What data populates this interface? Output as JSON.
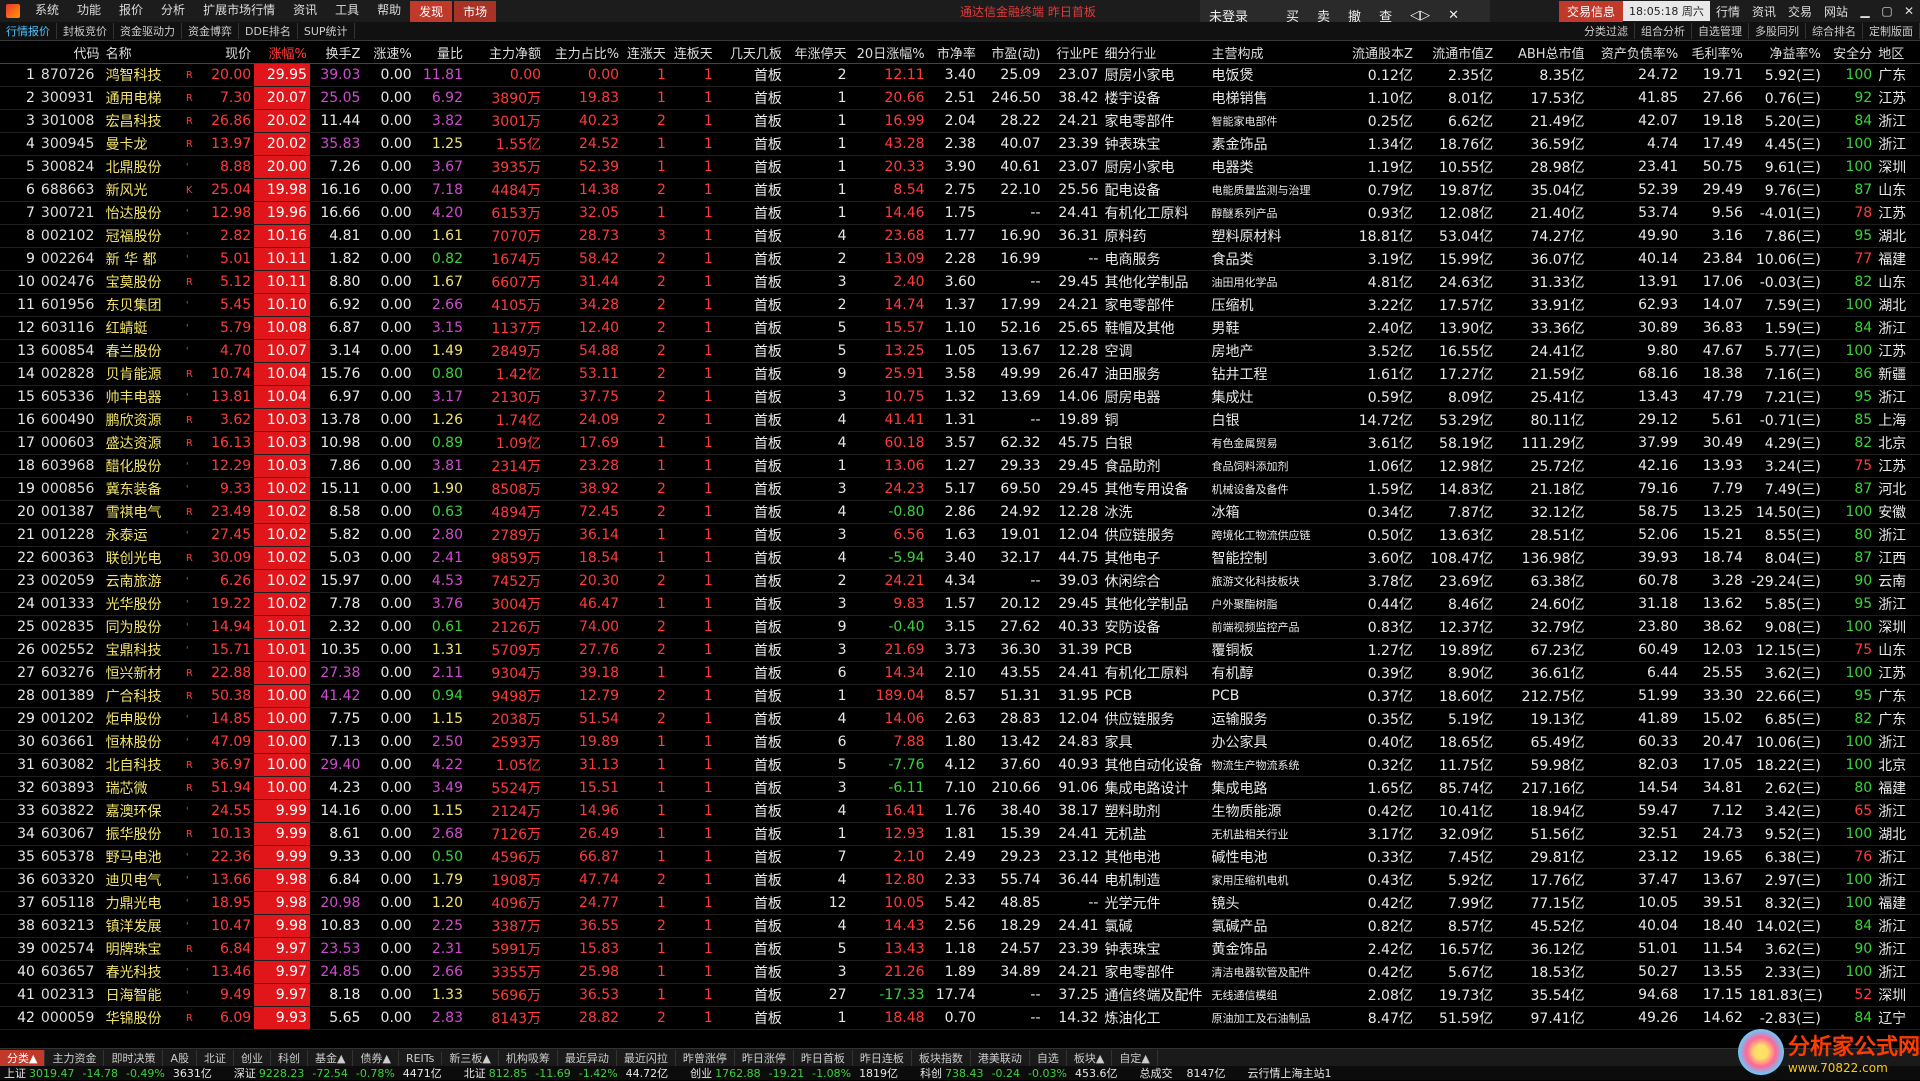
{
  "menubar": {
    "items": [
      "系统",
      "功能",
      "报价",
      "分析",
      "扩展市场行情",
      "资讯",
      "工具",
      "帮助"
    ],
    "highlight": [
      "发现",
      "市场"
    ],
    "marquee": "通达信金融终端  昨日首板",
    "ctrl": [
      "未登录",
      "买",
      "卖",
      "撤",
      "查",
      "◁▷",
      "✕"
    ],
    "right": {
      "trade_info": "交易信息",
      "clock": "18:05:18 周六",
      "items": [
        "行情",
        "资讯",
        "交易",
        "网站"
      ]
    }
  },
  "subbar": {
    "left": [
      "行情报价",
      "封板竞价",
      "资金驱动力",
      "资金博弈",
      "DDE排名",
      "SUP统计"
    ],
    "right": [
      "分类过滤",
      "组合分析",
      "自选管理",
      "多股同列",
      "综合排名",
      "定制版面"
    ]
  },
  "columns": [
    "",
    "代码",
    "名称",
    "",
    "现价",
    "涨幅%",
    "换手Z",
    "涨速%",
    "量比",
    "主力净额",
    "主力占比%",
    "连涨天",
    "连板天",
    "几天几板",
    "年涨停天",
    "20日涨幅%",
    "市净率",
    "市盈(动)",
    "行业PE",
    "细分行业",
    "主营构成",
    "流通股本Z",
    "流通市值Z",
    "ABH总市值",
    "资产负债率%",
    "毛利率%",
    "净益率%",
    "安全分",
    "地区"
  ],
  "rows": [
    [
      "1",
      "870726",
      "鸿智科技",
      "R",
      "20.00",
      "29.95",
      "39.03",
      "0.00",
      "11.81",
      "0.00",
      "0.00",
      "1",
      "1",
      "首板",
      "2",
      "12.11",
      "3.40",
      "25.09",
      "23.07",
      "厨房小家电",
      "电饭煲",
      "0.12亿",
      "2.35亿",
      "8.35亿",
      "24.72",
      "19.71",
      "5.92(三)",
      "100",
      "广东"
    ],
    [
      "2",
      "300931",
      "通用电梯",
      "R",
      "7.30",
      "20.07",
      "25.05",
      "0.00",
      "6.92",
      "3890万",
      "19.83",
      "1",
      "1",
      "首板",
      "1",
      "20.66",
      "2.51",
      "246.50",
      "38.42",
      "楼宇设备",
      "电梯销售",
      "1.10亿",
      "8.01亿",
      "17.53亿",
      "41.85",
      "27.66",
      "0.76(三)",
      "92",
      "江苏"
    ],
    [
      "3",
      "301008",
      "宏昌科技",
      "R",
      "26.86",
      "20.02",
      "11.44",
      "0.00",
      "3.82",
      "3001万",
      "40.23",
      "2",
      "1",
      "首板",
      "1",
      "16.99",
      "2.04",
      "28.22",
      "24.21",
      "家电零部件",
      "智能家电部件",
      "0.25亿",
      "6.62亿",
      "21.49亿",
      "42.07",
      "19.18",
      "5.20(三)",
      "84",
      "浙江"
    ],
    [
      "4",
      "300945",
      "曼卡龙",
      "R",
      "13.97",
      "20.02",
      "35.83",
      "0.00",
      "1.25",
      "1.55亿",
      "24.52",
      "1",
      "1",
      "首板",
      "1",
      "43.28",
      "2.38",
      "40.07",
      "23.39",
      "钟表珠宝",
      "素金饰品",
      "1.34亿",
      "18.76亿",
      "36.59亿",
      "4.74",
      "17.49",
      "4.45(三)",
      "100",
      "浙江"
    ],
    [
      "5",
      "300824",
      "北鼎股份",
      "'",
      "8.88",
      "20.00",
      "7.26",
      "0.00",
      "3.67",
      "3935万",
      "52.39",
      "1",
      "1",
      "首板",
      "1",
      "20.33",
      "3.90",
      "40.61",
      "23.07",
      "厨房小家电",
      "电器类",
      "1.19亿",
      "10.55亿",
      "28.98亿",
      "23.41",
      "50.75",
      "9.61(三)",
      "100",
      "深圳"
    ],
    [
      "6",
      "688663",
      "新风光",
      "K",
      "25.04",
      "19.98",
      "16.16",
      "0.00",
      "7.18",
      "4484万",
      "14.38",
      "2",
      "1",
      "首板",
      "1",
      "8.54",
      "2.75",
      "22.10",
      "25.56",
      "配电设备",
      "电能质量监测与治理",
      "0.79亿",
      "19.87亿",
      "35.04亿",
      "52.39",
      "29.49",
      "9.76(三)",
      "87",
      "山东"
    ],
    [
      "7",
      "300721",
      "怡达股份",
      "'",
      "12.98",
      "19.96",
      "16.66",
      "0.00",
      "4.20",
      "6153万",
      "32.05",
      "1",
      "1",
      "首板",
      "1",
      "14.46",
      "1.75",
      "--",
      "24.41",
      "有机化工原料",
      "醇醚系列产品",
      "0.93亿",
      "12.08亿",
      "21.40亿",
      "53.74",
      "9.56",
      "-4.01(三)",
      "78",
      "江苏"
    ],
    [
      "8",
      "002102",
      "冠福股份",
      "'",
      "2.82",
      "10.16",
      "4.81",
      "0.00",
      "1.61",
      "7070万",
      "28.73",
      "3",
      "1",
      "首板",
      "4",
      "23.68",
      "1.77",
      "16.90",
      "36.31",
      "原料药",
      "塑料原材料",
      "18.81亿",
      "53.04亿",
      "74.27亿",
      "49.90",
      "3.16",
      "7.86(三)",
      "95",
      "湖北"
    ],
    [
      "9",
      "002264",
      "新 华 都",
      "'",
      "5.01",
      "10.11",
      "1.82",
      "0.00",
      "0.82",
      "1674万",
      "58.42",
      "2",
      "1",
      "首板",
      "2",
      "13.09",
      "2.28",
      "16.99",
      "--",
      "电商服务",
      "食品类",
      "3.19亿",
      "15.99亿",
      "36.07亿",
      "40.14",
      "23.84",
      "10.06(三)",
      "77",
      "福建"
    ],
    [
      "10",
      "002476",
      "宝莫股份",
      "R",
      "5.12",
      "10.11",
      "8.80",
      "0.00",
      "1.67",
      "6607万",
      "31.44",
      "2",
      "1",
      "首板",
      "3",
      "2.40",
      "3.60",
      "--",
      "29.45",
      "其他化学制品",
      "油田用化学品",
      "4.81亿",
      "24.63亿",
      "31.33亿",
      "13.91",
      "17.06",
      "-0.03(三)",
      "82",
      "山东"
    ],
    [
      "11",
      "601956",
      "东贝集团",
      "'",
      "5.45",
      "10.10",
      "6.92",
      "0.00",
      "2.66",
      "4105万",
      "34.28",
      "2",
      "1",
      "首板",
      "2",
      "14.74",
      "1.37",
      "17.99",
      "24.21",
      "家电零部件",
      "压缩机",
      "3.22亿",
      "17.57亿",
      "33.91亿",
      "62.93",
      "14.07",
      "7.59(三)",
      "100",
      "湖北"
    ],
    [
      "12",
      "603116",
      "红蜻蜓",
      "'",
      "5.79",
      "10.08",
      "6.87",
      "0.00",
      "3.15",
      "1137万",
      "12.40",
      "2",
      "1",
      "首板",
      "5",
      "15.57",
      "1.10",
      "52.16",
      "25.65",
      "鞋帽及其他",
      "男鞋",
      "2.40亿",
      "13.90亿",
      "33.36亿",
      "30.89",
      "36.83",
      "1.59(三)",
      "84",
      "浙江"
    ],
    [
      "13",
      "600854",
      "春兰股份",
      "'",
      "4.70",
      "10.07",
      "3.14",
      "0.00",
      "1.49",
      "2849万",
      "54.88",
      "2",
      "1",
      "首板",
      "5",
      "13.25",
      "1.05",
      "13.67",
      "12.28",
      "空调",
      "房地产",
      "3.52亿",
      "16.55亿",
      "24.41亿",
      "9.80",
      "47.67",
      "5.77(三)",
      "100",
      "江苏"
    ],
    [
      "14",
      "002828",
      "贝肯能源",
      "R",
      "10.74",
      "10.04",
      "15.76",
      "0.00",
      "0.80",
      "1.42亿",
      "53.11",
      "2",
      "1",
      "首板",
      "9",
      "25.91",
      "3.58",
      "49.99",
      "26.47",
      "油田服务",
      "钻井工程",
      "1.61亿",
      "17.27亿",
      "21.59亿",
      "68.16",
      "18.38",
      "7.16(三)",
      "86",
      "新疆"
    ],
    [
      "15",
      "605336",
      "帅丰电器",
      "'",
      "13.81",
      "10.04",
      "6.97",
      "0.00",
      "3.17",
      "2130万",
      "37.75",
      "2",
      "1",
      "首板",
      "3",
      "10.75",
      "1.32",
      "13.69",
      "14.06",
      "厨房电器",
      "集成灶",
      "0.59亿",
      "8.09亿",
      "25.41亿",
      "13.43",
      "47.79",
      "7.21(三)",
      "95",
      "浙江"
    ],
    [
      "16",
      "600490",
      "鹏欣资源",
      "R",
      "3.62",
      "10.03",
      "13.78",
      "0.00",
      "1.26",
      "1.74亿",
      "24.09",
      "2",
      "1",
      "首板",
      "4",
      "41.41",
      "1.31",
      "--",
      "19.89",
      "铜",
      "白银",
      "14.72亿",
      "53.29亿",
      "80.11亿",
      "29.12",
      "5.61",
      "-0.71(三)",
      "85",
      "上海"
    ],
    [
      "17",
      "000603",
      "盛达资源",
      "R",
      "16.13",
      "10.03",
      "10.98",
      "0.00",
      "0.89",
      "1.09亿",
      "17.69",
      "1",
      "1",
      "首板",
      "4",
      "60.18",
      "3.57",
      "62.32",
      "45.75",
      "白银",
      "有色金属贸易",
      "3.61亿",
      "58.19亿",
      "111.29亿",
      "37.99",
      "30.49",
      "4.29(三)",
      "82",
      "北京"
    ],
    [
      "18",
      "603968",
      "醋化股份",
      "'",
      "12.29",
      "10.03",
      "7.86",
      "0.00",
      "3.81",
      "2314万",
      "23.28",
      "1",
      "1",
      "首板",
      "1",
      "13.06",
      "1.27",
      "29.33",
      "29.45",
      "食品助剂",
      "食品饲料添加剂",
      "1.06亿",
      "12.98亿",
      "25.72亿",
      "42.16",
      "13.93",
      "3.24(三)",
      "75",
      "江苏"
    ],
    [
      "19",
      "000856",
      "冀东装备",
      "'",
      "9.33",
      "10.02",
      "15.11",
      "0.00",
      "1.90",
      "8508万",
      "38.92",
      "2",
      "1",
      "首板",
      "3",
      "24.23",
      "5.17",
      "69.50",
      "29.45",
      "其他专用设备",
      "机械设备及备件",
      "1.59亿",
      "14.83亿",
      "21.18亿",
      "79.16",
      "7.79",
      "7.49(三)",
      "87",
      "河北"
    ],
    [
      "20",
      "001387",
      "雪祺电气",
      "R",
      "23.49",
      "10.02",
      "8.58",
      "0.00",
      "0.63",
      "4894万",
      "72.45",
      "2",
      "1",
      "首板",
      "4",
      "-0.80",
      "2.86",
      "24.92",
      "12.28",
      "冰洗",
      "冰箱",
      "0.34亿",
      "7.87亿",
      "32.12亿",
      "58.75",
      "13.25",
      "14.50(三)",
      "100",
      "安徽"
    ],
    [
      "21",
      "001228",
      "永泰运",
      "'",
      "27.45",
      "10.02",
      "5.82",
      "0.00",
      "2.80",
      "2789万",
      "36.14",
      "1",
      "1",
      "首板",
      "3",
      "6.56",
      "1.63",
      "19.01",
      "12.04",
      "供应链服务",
      "跨境化工物流供应链",
      "0.50亿",
      "13.63亿",
      "28.51亿",
      "52.06",
      "15.21",
      "8.55(三)",
      "80",
      "浙江"
    ],
    [
      "22",
      "600363",
      "联创光电",
      "R",
      "30.09",
      "10.02",
      "5.03",
      "0.00",
      "2.41",
      "9859万",
      "18.54",
      "1",
      "1",
      "首板",
      "4",
      "-5.94",
      "3.40",
      "32.17",
      "44.75",
      "其他电子",
      "智能控制",
      "3.60亿",
      "108.47亿",
      "136.98亿",
      "39.93",
      "18.74",
      "8.04(三)",
      "87",
      "江西"
    ],
    [
      "23",
      "002059",
      "云南旅游",
      "'",
      "6.26",
      "10.02",
      "15.97",
      "0.00",
      "4.53",
      "7452万",
      "20.30",
      "2",
      "1",
      "首板",
      "2",
      "24.21",
      "4.34",
      "--",
      "39.03",
      "休闲综合",
      "旅游文化科技板块",
      "3.78亿",
      "23.69亿",
      "63.38亿",
      "60.78",
      "3.28",
      "-29.24(三)",
      "90",
      "云南"
    ],
    [
      "24",
      "001333",
      "光华股份",
      "'",
      "19.22",
      "10.02",
      "7.78",
      "0.00",
      "3.76",
      "3004万",
      "46.47",
      "1",
      "1",
      "首板",
      "3",
      "9.83",
      "1.57",
      "20.12",
      "29.45",
      "其他化学制品",
      "户外聚酯树脂",
      "0.44亿",
      "8.46亿",
      "24.60亿",
      "31.18",
      "13.62",
      "5.85(三)",
      "95",
      "浙江"
    ],
    [
      "25",
      "002835",
      "同为股份",
      "'",
      "14.94",
      "10.01",
      "2.32",
      "0.00",
      "0.61",
      "2126万",
      "74.00",
      "2",
      "1",
      "首板",
      "9",
      "-0.40",
      "3.15",
      "27.62",
      "40.33",
      "安防设备",
      "前端视频监控产品",
      "0.83亿",
      "12.37亿",
      "32.79亿",
      "23.80",
      "38.62",
      "9.08(三)",
      "100",
      "深圳"
    ],
    [
      "26",
      "002552",
      "宝鼎科技",
      "'",
      "15.71",
      "10.01",
      "10.35",
      "0.00",
      "1.31",
      "5709万",
      "27.76",
      "2",
      "1",
      "首板",
      "3",
      "21.69",
      "3.73",
      "36.30",
      "31.39",
      "PCB",
      "覆铜板",
      "1.27亿",
      "19.89亿",
      "67.23亿",
      "60.49",
      "12.03",
      "12.15(三)",
      "75",
      "山东"
    ],
    [
      "27",
      "603276",
      "恒兴新材",
      "R",
      "22.88",
      "10.00",
      "27.38",
      "0.00",
      "2.11",
      "9304万",
      "39.18",
      "1",
      "1",
      "首板",
      "6",
      "14.34",
      "2.10",
      "43.55",
      "24.41",
      "有机化工原料",
      "有机醇",
      "0.39亿",
      "8.90亿",
      "36.61亿",
      "6.44",
      "25.55",
      "3.62(三)",
      "100",
      "江苏"
    ],
    [
      "28",
      "001389",
      "广合科技",
      "R",
      "50.38",
      "10.00",
      "41.42",
      "0.00",
      "0.94",
      "9498万",
      "12.79",
      "2",
      "1",
      "首板",
      "1",
      "189.04",
      "8.57",
      "51.31",
      "31.95",
      "PCB",
      "PCB",
      "0.37亿",
      "18.60亿",
      "212.75亿",
      "51.99",
      "33.30",
      "22.66(三)",
      "95",
      "广东"
    ],
    [
      "29",
      "001202",
      "炬申股份",
      "'",
      "14.85",
      "10.00",
      "7.75",
      "0.00",
      "1.15",
      "2038万",
      "51.54",
      "2",
      "1",
      "首板",
      "4",
      "14.06",
      "2.63",
      "28.83",
      "12.04",
      "供应链服务",
      "运输服务",
      "0.35亿",
      "5.19亿",
      "19.13亿",
      "41.89",
      "15.02",
      "6.85(三)",
      "82",
      "广东"
    ],
    [
      "30",
      "603661",
      "恒林股份",
      "'",
      "47.09",
      "10.00",
      "7.13",
      "0.00",
      "2.50",
      "2593万",
      "19.89",
      "1",
      "1",
      "首板",
      "6",
      "7.88",
      "1.80",
      "13.42",
      "24.83",
      "家具",
      "办公家具",
      "0.40亿",
      "18.65亿",
      "65.49亿",
      "60.33",
      "20.47",
      "10.06(三)",
      "100",
      "浙江"
    ],
    [
      "31",
      "603082",
      "北自科技",
      "R",
      "36.97",
      "10.00",
      "29.40",
      "0.00",
      "4.22",
      "1.05亿",
      "31.13",
      "1",
      "1",
      "首板",
      "5",
      "-7.76",
      "4.12",
      "37.60",
      "40.93",
      "其他自动化设备",
      "物流生产物流系统",
      "0.32亿",
      "11.75亿",
      "59.98亿",
      "82.03",
      "17.05",
      "18.22(三)",
      "100",
      "北京"
    ],
    [
      "32",
      "603893",
      "瑞芯微",
      "R",
      "51.94",
      "10.00",
      "4.23",
      "0.00",
      "3.49",
      "5524万",
      "15.51",
      "1",
      "1",
      "首板",
      "3",
      "-6.11",
      "7.10",
      "210.66",
      "91.06",
      "集成电路设计",
      "集成电路",
      "1.65亿",
      "85.74亿",
      "217.16亿",
      "14.54",
      "34.81",
      "2.62(三)",
      "80",
      "福建"
    ],
    [
      "33",
      "603822",
      "嘉澳环保",
      "'",
      "24.55",
      "9.99",
      "14.16",
      "0.00",
      "1.15",
      "2124万",
      "14.96",
      "1",
      "1",
      "首板",
      "4",
      "16.41",
      "1.76",
      "38.40",
      "38.17",
      "塑料助剂",
      "生物质能源",
      "0.42亿",
      "10.41亿",
      "18.94亿",
      "59.47",
      "7.12",
      "3.42(三)",
      "65",
      "浙江"
    ],
    [
      "34",
      "603067",
      "振华股份",
      "R",
      "10.13",
      "9.99",
      "8.61",
      "0.00",
      "2.68",
      "7126万",
      "26.49",
      "1",
      "1",
      "首板",
      "1",
      "12.93",
      "1.81",
      "15.39",
      "24.41",
      "无机盐",
      "无机盐相关行业",
      "3.17亿",
      "32.09亿",
      "51.56亿",
      "32.51",
      "24.73",
      "9.52(三)",
      "100",
      "湖北"
    ],
    [
      "35",
      "605378",
      "野马电池",
      "'",
      "22.36",
      "9.99",
      "9.33",
      "0.00",
      "0.50",
      "4596万",
      "66.87",
      "1",
      "1",
      "首板",
      "7",
      "2.10",
      "2.49",
      "29.23",
      "23.12",
      "其他电池",
      "碱性电池",
      "0.33亿",
      "7.45亿",
      "29.81亿",
      "23.12",
      "19.65",
      "6.38(三)",
      "76",
      "浙江"
    ],
    [
      "36",
      "603320",
      "迪贝电气",
      "'",
      "13.66",
      "9.98",
      "6.84",
      "0.00",
      "1.79",
      "1908万",
      "47.74",
      "2",
      "1",
      "首板",
      "4",
      "12.80",
      "2.33",
      "55.74",
      "36.44",
      "电机制造",
      "家用压缩机电机",
      "0.43亿",
      "5.92亿",
      "17.76亿",
      "37.47",
      "13.67",
      "2.97(三)",
      "100",
      "浙江"
    ],
    [
      "37",
      "605118",
      "力鼎光电",
      "'",
      "18.95",
      "9.98",
      "20.98",
      "0.00",
      "1.20",
      "4096万",
      "24.77",
      "1",
      "1",
      "首板",
      "12",
      "10.05",
      "5.42",
      "48.85",
      "--",
      "光学元件",
      "镜头",
      "0.42亿",
      "7.99亿",
      "77.15亿",
      "10.05",
      "39.51",
      "8.32(三)",
      "100",
      "福建"
    ],
    [
      "38",
      "603213",
      "镇洋发展",
      "'",
      "10.47",
      "9.98",
      "10.83",
      "0.00",
      "2.25",
      "3387万",
      "36.55",
      "2",
      "1",
      "首板",
      "4",
      "14.43",
      "2.56",
      "18.29",
      "24.41",
      "氯碱",
      "氯碱产品",
      "0.82亿",
      "8.57亿",
      "45.52亿",
      "40.04",
      "18.40",
      "14.02(三)",
      "84",
      "浙江"
    ],
    [
      "39",
      "002574",
      "明牌珠宝",
      "R",
      "6.84",
      "9.97",
      "23.53",
      "0.00",
      "2.31",
      "5991万",
      "15.83",
      "1",
      "1",
      "首板",
      "5",
      "13.43",
      "1.18",
      "24.57",
      "23.39",
      "钟表珠宝",
      "黄金饰品",
      "2.42亿",
      "16.57亿",
      "36.12亿",
      "51.01",
      "11.54",
      "3.62(三)",
      "90",
      "浙江"
    ],
    [
      "40",
      "603657",
      "春光科技",
      "'",
      "13.46",
      "9.97",
      "24.85",
      "0.00",
      "2.66",
      "3355万",
      "25.98",
      "1",
      "1",
      "首板",
      "3",
      "21.26",
      "1.89",
      "34.89",
      "24.21",
      "家电零部件",
      "清洁电器软管及配件",
      "0.42亿",
      "5.67亿",
      "18.53亿",
      "50.27",
      "13.55",
      "2.33(三)",
      "100",
      "浙江"
    ],
    [
      "41",
      "002313",
      "日海智能",
      "'",
      "9.49",
      "9.97",
      "8.18",
      "0.00",
      "1.33",
      "5696万",
      "36.53",
      "1",
      "1",
      "首板",
      "27",
      "-17.33",
      "17.74",
      "--",
      "37.25",
      "通信终端及配件",
      "无线通信模组",
      "2.08亿",
      "19.73亿",
      "35.54亿",
      "94.68",
      "17.15",
      "181.83(三)",
      "52",
      "深圳"
    ],
    [
      "42",
      "000059",
      "华锦股份",
      "R",
      "6.09",
      "9.93",
      "5.65",
      "0.00",
      "2.83",
      "8143万",
      "28.82",
      "2",
      "1",
      "首板",
      "1",
      "18.48",
      "0.70",
      "--",
      "14.32",
      "炼油化工",
      "原油加工及石油制品",
      "8.47亿",
      "51.59亿",
      "97.41亿",
      "49.26",
      "14.62",
      "-2.83(三)",
      "84",
      "辽宁"
    ]
  ],
  "tabs": [
    "分类▲",
    "主力资金",
    "即时决策",
    "A股",
    "北证",
    "创业",
    "科创",
    "基金▲",
    "债券▲",
    "REITs",
    "新三板▲",
    "机构吸筹",
    "最近异动",
    "最近闪拉",
    "昨曾涨停",
    "昨日涨停",
    "昨日首板",
    "昨日连板",
    "板块指数",
    "港美联动",
    "自选",
    "板块▲",
    "自定▲"
  ],
  "status": [
    {
      "label": "上证",
      "v1": "3019.47",
      "v2": "-14.78",
      "v3": "-0.49%",
      "v4": "3631亿"
    },
    {
      "label": "深证",
      "v1": "9228.23",
      "v2": "-72.54",
      "v3": "-0.78%",
      "v4": "4471亿"
    },
    {
      "label": "北证",
      "v1": "812.85",
      "v2": "-11.69",
      "v3": "-1.42%",
      "v4": "44.72亿"
    },
    {
      "label": "创业",
      "v1": "1762.88",
      "v2": "-19.21",
      "v3": "-1.08%",
      "v4": "1819亿"
    },
    {
      "label": "科创",
      "v1": "738.43",
      "v2": "-0.24",
      "v3": "-0.03%",
      "v4": "453.6亿"
    }
  ],
  "status_total": {
    "label": "总成交",
    "value": "8147亿",
    "server": "云行情上海主站1"
  },
  "logo": {
    "title": "分析家公式网",
    "url": "www.70822.com"
  }
}
